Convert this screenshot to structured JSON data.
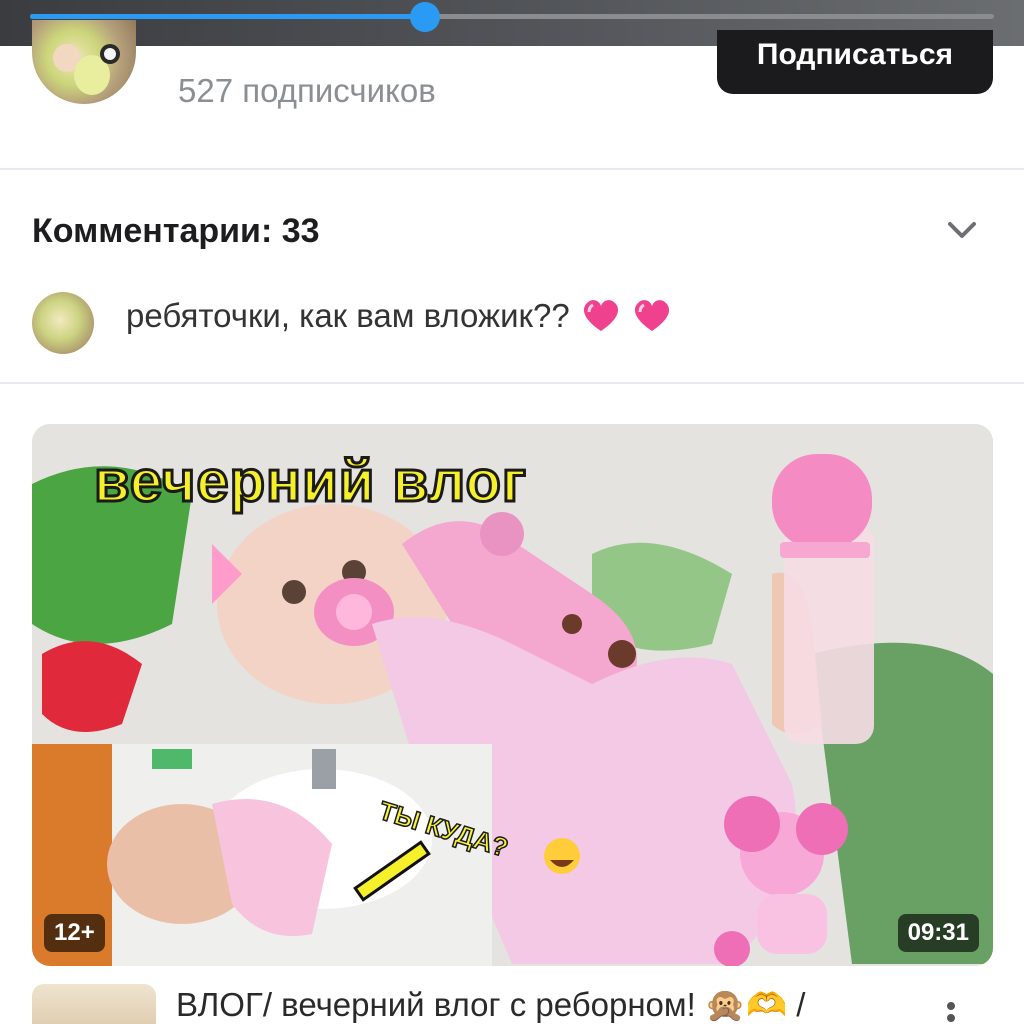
{
  "player": {
    "progress": 0.41
  },
  "channel": {
    "subscribers": "527 подписчиков",
    "subscribe_label": "Подписаться"
  },
  "comments": {
    "title": "Комментарии: 33",
    "first_comment": "ребяточки, как вам вложик??",
    "emoji": [
      "heart-icon",
      "heart-icon"
    ]
  },
  "video": {
    "thumbnail_title": "вечерний влог",
    "sticker_text": "ТЫ КУДА?",
    "age_rating": "12+",
    "duration": "09:31"
  },
  "next_video": {
    "title": "ВЛОГ/ вечерний влог с реборном! 🙊🫶 /"
  },
  "colors": {
    "accent": "#2b9af3",
    "subscribe_bg": "#1b1b1d",
    "heart": "#f0418f",
    "title_yellow": "#f5f02a"
  }
}
